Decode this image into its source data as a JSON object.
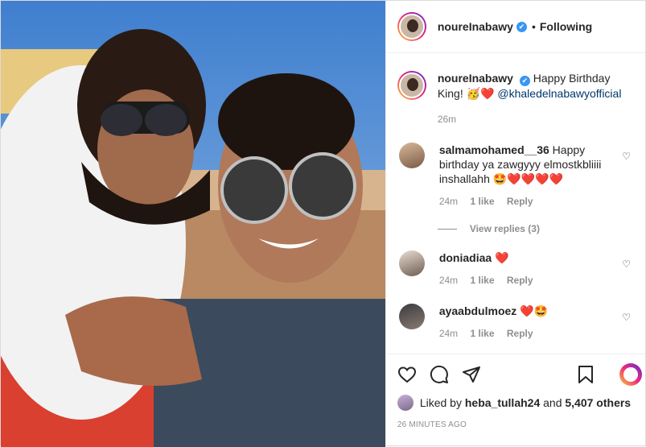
{
  "header": {
    "username": "noureInabawy",
    "verified_glyph": "✔",
    "separator": "•",
    "follow_status": "Following"
  },
  "caption": {
    "username": "noureInabawy",
    "text_start": "Happy Birthday King!",
    "emoji": "🥳❤️",
    "mention": "@khaledelnabawyofficial",
    "time": "26m"
  },
  "comments": [
    {
      "username": "salmamohamed__36",
      "text": "Happy birthday ya zawgyyy elmostkbliiii inshallahh",
      "emoji": "🤩❤️❤️❤️❤️",
      "time": "24m",
      "likes": "1 like",
      "reply": "Reply",
      "view_replies": "View replies (3)"
    },
    {
      "username": "doniadiaa",
      "text": "",
      "emoji": "❤️",
      "time": "24m",
      "likes": "1 like",
      "reply": "Reply"
    },
    {
      "username": "ayaabdulmoez",
      "text": "",
      "emoji": "❤️🤩",
      "time": "24m",
      "likes": "1 like",
      "reply": "Reply"
    }
  ],
  "footer": {
    "liked_prefix": "Liked by",
    "liked_user": "heba_tullah24",
    "liked_and": "and",
    "liked_others": "5,407 others",
    "date": "26 MINUTES AGO"
  },
  "icons": [
    "heart-icon",
    "comment-icon",
    "share-icon",
    "bookmark-icon",
    "story-ring-icon"
  ],
  "colors": {
    "link": "#00376b",
    "muted": "#8e8e8e",
    "verified": "#3897f0",
    "heart": "#ed4956"
  }
}
